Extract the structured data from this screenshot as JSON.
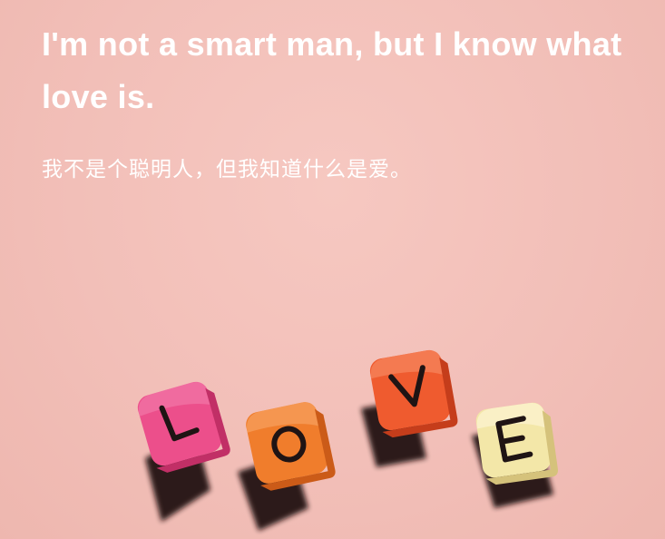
{
  "quote": {
    "english": "I'm not a smart man, but I know what love is.",
    "chinese": "我不是个聪明人，但我知道什么是爱。"
  },
  "image": {
    "description_letters": [
      "L",
      "O",
      "V",
      "E"
    ],
    "colors": {
      "background": "#f2c0b9",
      "text": "#ffffff",
      "cube_l": "#ea4f86",
      "cube_o": "#f07a2e",
      "cube_v": "#ee5a30",
      "cube_e": "#f1e6a4"
    }
  }
}
